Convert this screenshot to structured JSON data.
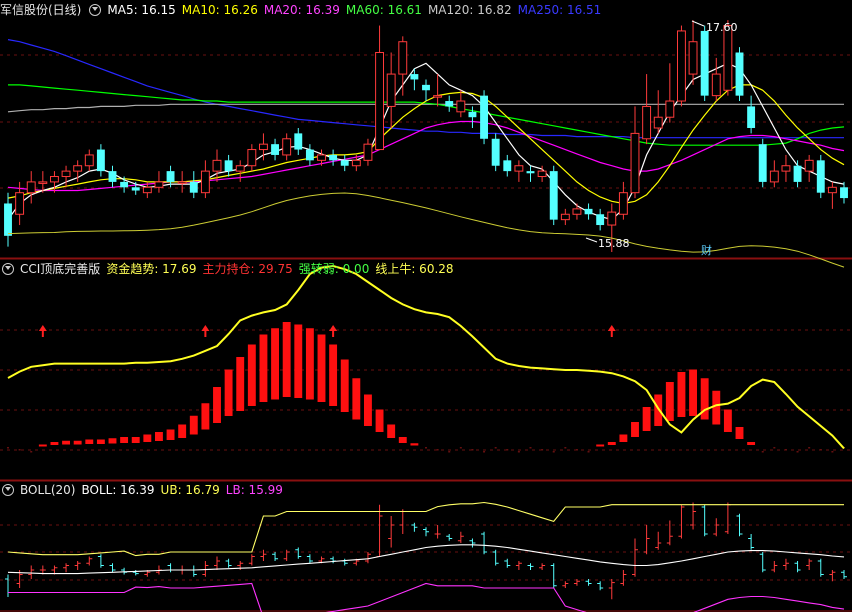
{
  "main_header": {
    "stock": "军信股份(日线)",
    "ma5": "MA5: 16.15",
    "ma10": "MA10: 16.26",
    "ma20": "MA20: 16.39",
    "ma60": "MA60: 16.61",
    "ma120": "MA120: 16.82",
    "ma250": "MA250: 16.51"
  },
  "cci_header": {
    "name": "CCI顶底完善版",
    "zjqs": "资金趋势: 17.69",
    "zlcc": "主力持仓: 29.75",
    "qzr": "强转弱: 0.00",
    "xsn": "线上牛: 60.28"
  },
  "boll_header": {
    "name": "BOLL(20)",
    "boll": "BOLL: 16.39",
    "ub": "UB: 16.79",
    "lb": "LB: 15.99"
  },
  "annotations": {
    "high": "17.60",
    "low": "15.88",
    "cai": "财"
  },
  "colors": {
    "up": "#ff3b3b",
    "down": "#54ffff",
    "ma5": "#ffffff",
    "ma10": "#ffff00",
    "ma20": "#ff00ff",
    "ma60": "#00ff00",
    "ma120": "#b0b0b0",
    "ma250": "#2828ff",
    "cci_line": "#ffff22",
    "cci_smooth": "#cccc33",
    "bar": "#ff1010",
    "boll_mid": "#ffffff",
    "boll_ub": "#ffff66",
    "boll_lb": "#ff33ff"
  },
  "chart_data": [
    {
      "type": "candlestick",
      "title": "军信股份(日线)",
      "low_mark": 15.88,
      "high_mark": 17.6,
      "candles": [
        [
          15.9,
          15.6,
          16.0,
          15.5
        ],
        [
          15.8,
          16.0,
          16.1,
          15.7
        ],
        [
          16.0,
          16.1,
          16.2,
          15.9
        ],
        [
          16.1,
          16.1,
          16.2,
          16.0
        ],
        [
          16.1,
          16.15,
          16.2,
          16.0
        ],
        [
          16.15,
          16.2,
          16.25,
          16.05
        ],
        [
          16.2,
          16.25,
          16.3,
          16.1
        ],
        [
          16.25,
          16.35,
          16.4,
          16.2
        ],
        [
          16.4,
          16.2,
          16.45,
          16.15
        ],
        [
          16.2,
          16.1,
          16.25,
          16.05
        ],
        [
          16.1,
          16.05,
          16.15,
          16.0
        ],
        [
          16.05,
          16.02,
          16.1,
          15.98
        ],
        [
          16.0,
          16.05,
          16.1,
          15.95
        ],
        [
          16.05,
          16.1,
          16.2,
          16.0
        ],
        [
          16.2,
          16.1,
          16.25,
          16.05
        ],
        [
          16.1,
          16.1,
          16.2,
          16.0
        ],
        [
          16.1,
          16.0,
          16.2,
          15.95
        ],
        [
          16.0,
          16.2,
          16.3,
          15.95
        ],
        [
          16.2,
          16.3,
          16.4,
          16.1
        ],
        [
          16.3,
          16.2,
          16.35,
          16.15
        ],
        [
          16.2,
          16.25,
          16.3,
          16.1
        ],
        [
          16.25,
          16.4,
          16.45,
          16.2
        ],
        [
          16.4,
          16.45,
          16.55,
          16.3
        ],
        [
          16.45,
          16.35,
          16.5,
          16.3
        ],
        [
          16.35,
          16.5,
          16.55,
          16.3
        ],
        [
          16.55,
          16.4,
          16.6,
          16.35
        ],
        [
          16.4,
          16.3,
          16.45,
          16.25
        ],
        [
          16.3,
          16.35,
          16.4,
          16.25
        ],
        [
          16.35,
          16.3,
          16.4,
          16.25
        ],
        [
          16.3,
          16.25,
          16.35,
          16.2
        ],
        [
          16.25,
          16.3,
          16.35,
          16.2
        ],
        [
          16.3,
          16.45,
          16.5,
          16.25
        ],
        [
          16.4,
          17.3,
          17.55,
          16.4
        ],
        [
          16.8,
          17.1,
          17.3,
          16.6
        ],
        [
          17.1,
          17.4,
          17.45,
          16.9
        ],
        [
          17.1,
          17.05,
          17.15,
          16.95
        ],
        [
          17.0,
          16.95,
          17.05,
          16.85
        ],
        [
          16.9,
          16.9,
          17.1,
          16.8
        ],
        [
          16.85,
          16.8,
          16.9,
          16.75
        ],
        [
          16.75,
          16.85,
          16.95,
          16.7
        ],
        [
          16.75,
          16.7,
          16.8,
          16.6
        ],
        [
          16.9,
          16.5,
          16.95,
          16.45
        ],
        [
          16.5,
          16.25,
          16.55,
          16.2
        ],
        [
          16.3,
          16.2,
          16.35,
          16.15
        ],
        [
          16.2,
          16.25,
          16.3,
          16.1
        ],
        [
          16.2,
          16.18,
          16.25,
          16.1
        ],
        [
          16.15,
          16.2,
          16.25,
          16.1
        ],
        [
          16.2,
          15.75,
          16.25,
          15.7
        ],
        [
          15.75,
          15.8,
          15.85,
          15.7
        ],
        [
          15.8,
          15.85,
          15.9,
          15.75
        ],
        [
          15.85,
          15.8,
          15.9,
          15.75
        ],
        [
          15.8,
          15.7,
          15.85,
          15.65
        ],
        [
          15.7,
          15.82,
          15.9,
          15.45
        ],
        [
          15.8,
          16.0,
          16.1,
          15.75
        ],
        [
          16.0,
          16.55,
          16.8,
          15.95
        ],
        [
          16.5,
          16.8,
          17.1,
          16.45
        ],
        [
          16.6,
          16.7,
          16.95,
          16.55
        ],
        [
          16.7,
          16.85,
          17.2,
          16.65
        ],
        [
          16.85,
          17.5,
          17.55,
          16.8
        ],
        [
          17.1,
          17.4,
          17.6,
          17.0
        ],
        [
          17.5,
          16.9,
          17.55,
          16.85
        ],
        [
          16.9,
          17.1,
          17.25,
          16.85
        ],
        [
          16.95,
          17.55,
          17.6,
          16.9
        ],
        [
          17.3,
          16.9,
          17.35,
          16.85
        ],
        [
          16.8,
          16.6,
          16.9,
          16.55
        ],
        [
          16.45,
          16.1,
          16.5,
          16.05
        ],
        [
          16.1,
          16.2,
          16.3,
          16.05
        ],
        [
          16.2,
          16.25,
          16.35,
          16.1
        ],
        [
          16.25,
          16.1,
          16.3,
          16.05
        ],
        [
          16.2,
          16.3,
          16.35,
          16.1
        ],
        [
          16.3,
          16.0,
          16.35,
          15.95
        ],
        [
          16.0,
          16.05,
          16.1,
          15.85
        ],
        [
          16.05,
          15.95,
          16.1,
          15.9
        ]
      ],
      "ma5": [
        15.75,
        15.9,
        15.98,
        16.02,
        16.05,
        16.1,
        16.14,
        16.2,
        16.22,
        16.18,
        16.12,
        16.08,
        16.05,
        16.06,
        16.08,
        16.08,
        16.08,
        16.12,
        16.18,
        16.2,
        16.22,
        16.28,
        16.35,
        16.38,
        16.42,
        16.43,
        16.4,
        16.36,
        16.32,
        16.3,
        16.3,
        16.35,
        16.6,
        16.85,
        17.0,
        17.15,
        17.2,
        17.1,
        17.0,
        16.95,
        16.9,
        16.8,
        16.65,
        16.5,
        16.35,
        16.25,
        16.22,
        16.1,
        15.98,
        15.88,
        15.82,
        15.78,
        15.75,
        15.85,
        16.05,
        16.35,
        16.55,
        16.75,
        16.9,
        17.05,
        17.1,
        17.15,
        17.2,
        17.15,
        17.0,
        16.8,
        16.6,
        16.4,
        16.25,
        16.2,
        16.15,
        16.1,
        16.08
      ],
      "ma10": [
        15.95,
        15.97,
        16.0,
        16.02,
        16.04,
        16.06,
        16.08,
        16.1,
        16.12,
        16.13,
        16.13,
        16.12,
        16.1,
        16.1,
        16.1,
        16.1,
        16.11,
        16.12,
        16.14,
        16.16,
        16.18,
        16.2,
        16.22,
        16.25,
        16.28,
        16.3,
        16.32,
        16.34,
        16.35,
        16.35,
        16.36,
        16.38,
        16.5,
        16.6,
        16.7,
        16.78,
        16.85,
        16.9,
        16.92,
        16.93,
        16.92,
        16.88,
        16.8,
        16.7,
        16.6,
        16.5,
        16.4,
        16.3,
        16.2,
        16.1,
        16.02,
        15.96,
        15.92,
        15.9,
        15.92,
        15.98,
        16.1,
        16.25,
        16.42,
        16.58,
        16.72,
        16.85,
        16.95,
        17.0,
        17.0,
        16.95,
        16.85,
        16.72,
        16.6,
        16.5,
        16.4,
        16.32,
        16.26
      ],
      "ma20": [
        16.05,
        16.04,
        16.03,
        16.02,
        16.02,
        16.02,
        16.02,
        16.03,
        16.04,
        16.05,
        16.06,
        16.07,
        16.08,
        16.09,
        16.1,
        16.1,
        16.1,
        16.11,
        16.12,
        16.13,
        16.14,
        16.15,
        16.17,
        16.19,
        16.21,
        16.23,
        16.25,
        16.27,
        16.29,
        16.31,
        16.33,
        16.35,
        16.4,
        16.45,
        16.5,
        16.55,
        16.6,
        16.63,
        16.65,
        16.66,
        16.66,
        16.65,
        16.63,
        16.6,
        16.56,
        16.52,
        16.48,
        16.44,
        16.4,
        16.36,
        16.32,
        16.28,
        16.25,
        16.22,
        16.2,
        16.2,
        16.22,
        16.26,
        16.3,
        16.35,
        16.4,
        16.45,
        16.5,
        16.52,
        16.53,
        16.53,
        16.52,
        16.5,
        16.48,
        16.46,
        16.44,
        16.41,
        16.39
      ],
      "ma60": [
        17.0,
        17.0,
        16.99,
        16.98,
        16.97,
        16.96,
        16.95,
        16.94,
        16.93,
        16.92,
        16.91,
        16.9,
        16.89,
        16.88,
        16.87,
        16.86,
        16.86,
        16.85,
        16.85,
        16.84,
        16.84,
        16.84,
        16.84,
        16.84,
        16.84,
        16.84,
        16.84,
        16.84,
        16.84,
        16.84,
        16.84,
        16.84,
        16.84,
        16.84,
        16.84,
        16.84,
        16.83,
        16.82,
        16.8,
        16.78,
        16.76,
        16.74,
        16.72,
        16.7,
        16.68,
        16.66,
        16.64,
        16.62,
        16.6,
        16.58,
        16.56,
        16.54,
        16.52,
        16.5,
        16.48,
        16.46,
        16.45,
        16.44,
        16.44,
        16.44,
        16.44,
        16.44,
        16.44,
        16.44,
        16.44,
        16.44,
        16.45,
        16.46,
        16.5,
        16.55,
        16.58,
        16.6,
        16.61
      ],
      "ma120": [
        16.75,
        16.76,
        16.77,
        16.77,
        16.78,
        16.78,
        16.79,
        16.79,
        16.8,
        16.8,
        16.8,
        16.81,
        16.81,
        16.81,
        16.82,
        16.82,
        16.82,
        16.82,
        16.82,
        16.82,
        16.82,
        16.82,
        16.82,
        16.82,
        16.82,
        16.82,
        16.82,
        16.82,
        16.82,
        16.82,
        16.82,
        16.82,
        16.82,
        16.82,
        16.82,
        16.82,
        16.82,
        16.82,
        16.82,
        16.82,
        16.82,
        16.82,
        16.82,
        16.82,
        16.82,
        16.82,
        16.82,
        16.82,
        16.82,
        16.82,
        16.82,
        16.82,
        16.82,
        16.82,
        16.82,
        16.82,
        16.82,
        16.82,
        16.82,
        16.82,
        16.82,
        16.82,
        16.82,
        16.82,
        16.82,
        16.82,
        16.82,
        16.82,
        16.82,
        16.82,
        16.82,
        16.82,
        16.82
      ],
      "ma250": [
        17.42,
        17.4,
        17.37,
        17.34,
        17.31,
        17.27,
        17.23,
        17.19,
        17.15,
        17.11,
        17.07,
        17.03,
        16.99,
        16.96,
        16.93,
        16.9,
        16.87,
        16.84,
        16.82,
        16.8,
        16.78,
        16.76,
        16.74,
        16.72,
        16.7,
        16.68,
        16.67,
        16.66,
        16.65,
        16.64,
        16.63,
        16.62,
        16.61,
        16.6,
        16.59,
        16.58,
        16.57,
        16.57,
        16.56,
        16.56,
        16.55,
        16.55,
        16.55,
        16.54,
        16.54,
        16.54,
        16.53,
        16.53,
        16.53,
        16.52,
        16.52,
        16.52,
        16.52,
        16.52,
        16.51,
        16.51,
        16.51,
        16.51,
        16.51,
        16.51,
        16.51,
        16.51,
        16.51,
        16.51,
        16.51,
        16.51,
        16.51,
        16.51,
        16.51,
        16.51,
        16.51,
        16.51,
        16.51
      ]
    },
    {
      "type": "line",
      "title": "CCI顶底完善版",
      "series_line": [
        -10,
        -2,
        4,
        6,
        8,
        8,
        8,
        8,
        8,
        8,
        8,
        9,
        9,
        10,
        11,
        14,
        18,
        24,
        30,
        45,
        62,
        68,
        72,
        75,
        82,
        100,
        120,
        128,
        130,
        126,
        120,
        110,
        100,
        90,
        82,
        76,
        72,
        70,
        66,
        55,
        42,
        28,
        14,
        8,
        5,
        3,
        2,
        1,
        0,
        0,
        -1,
        -2,
        -4,
        -8,
        -14,
        -25,
        -48,
        -68,
        -78,
        -62,
        -50,
        -44,
        -42,
        -35,
        -20,
        -12,
        -15,
        -30,
        -46,
        -58,
        -70,
        -82,
        -98,
        -108,
        -115,
        -120,
        -130
      ],
      "signals": [
        3,
        17,
        28,
        52
      ],
      "bars": [
        0,
        0,
        0,
        2,
        4,
        5,
        5,
        6,
        6,
        7,
        8,
        8,
        10,
        12,
        14,
        18,
        25,
        35,
        48,
        62,
        72,
        82,
        90,
        95,
        100,
        98,
        95,
        90,
        82,
        70,
        55,
        42,
        30,
        18,
        8,
        3,
        0,
        0,
        0,
        0,
        0,
        0,
        0,
        0,
        0,
        0,
        0,
        0,
        0,
        0,
        0,
        2,
        4,
        10,
        20,
        32,
        42,
        52,
        60,
        62,
        55,
        45,
        30,
        16,
        4,
        0,
        0,
        0,
        0,
        0,
        0,
        0,
        0
      ]
    },
    {
      "type": "line",
      "title": "BOLL(20)",
      "boll": 16.39,
      "ub": 16.79,
      "lb": 15.99
    }
  ]
}
